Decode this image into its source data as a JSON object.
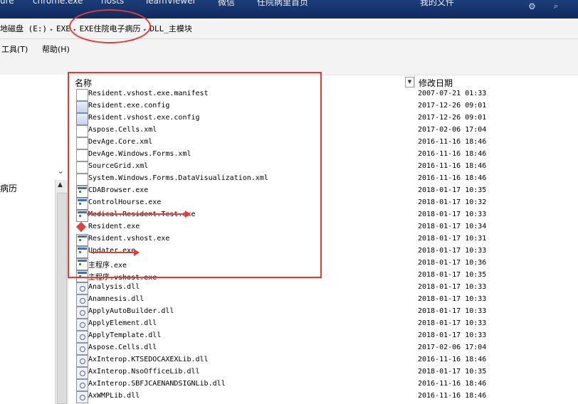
{
  "taskbar": {
    "items": [
      "ure",
      "chrome.exe",
      "hosts",
      "TeamViewer",
      "微信",
      "任院病里首页"
    ],
    "right_text": "我的文件"
  },
  "address": {
    "crumbs": [
      "地磁盘 (E:)",
      "EXE",
      "EXE住院电子病历",
      "DLL_主模块"
    ]
  },
  "menu": {
    "tools": "工具(T)",
    "help": "帮助(H)"
  },
  "nav": {
    "item_label": "病历"
  },
  "columns": {
    "name": "名称",
    "date": "修改日期"
  },
  "files": [
    {
      "name": "Resident.vshost.exe.manifest",
      "date": "2007-07-21 01:33",
      "icon": "doc"
    },
    {
      "name": "Resident.exe.config",
      "date": "2017-12-26 09:01",
      "icon": "cfg"
    },
    {
      "name": "Resident.vshost.exe.config",
      "date": "2017-12-26 09:01",
      "icon": "cfg"
    },
    {
      "name": "Aspose.Cells.xml",
      "date": "2017-02-06 17:04",
      "icon": "doc"
    },
    {
      "name": "DevAge.Core.xml",
      "date": "2016-11-16 18:46",
      "icon": "doc"
    },
    {
      "name": "DevAge.Windows.Forms.xml",
      "date": "2016-11-16 18:46",
      "icon": "doc"
    },
    {
      "name": "SourceGrid.xml",
      "date": "2016-11-16 18:46",
      "icon": "doc"
    },
    {
      "name": "System.Windows.Forms.DataVisualization.xml",
      "date": "2016-11-16 18:46",
      "icon": "doc"
    },
    {
      "name": "CDABrowser.exe",
      "date": "2018-01-17 10:35",
      "icon": "exe"
    },
    {
      "name": "ControlHourse.exe",
      "date": "2018-01-17 10:32",
      "icon": "exe"
    },
    {
      "name": "Medical.Resident.Test.exe",
      "date": "2018-01-17 10:33",
      "icon": "exe"
    },
    {
      "name": "Resident.exe",
      "date": "2018-01-17 10:34",
      "icon": "app"
    },
    {
      "name": "Resident.vshost.exe",
      "date": "2018-01-17 10:31",
      "icon": "exe"
    },
    {
      "name": "Updater.exe",
      "date": "2018-01-17 10:33",
      "icon": "exe"
    },
    {
      "name": "主程序.exe",
      "date": "2018-01-17 10:36",
      "icon": "exe"
    },
    {
      "name": "主程序.vshost.exe",
      "date": "2018-01-17 10:35",
      "icon": "exe"
    },
    {
      "name": "Analysis.dll",
      "date": "2018-01-17 10:33",
      "icon": "dll"
    },
    {
      "name": "Anamnesis.dll",
      "date": "2018-01-17 10:33",
      "icon": "dll"
    },
    {
      "name": "ApplyAutoBuilder.dll",
      "date": "2018-01-17 10:33",
      "icon": "dll"
    },
    {
      "name": "ApplyElement.dll",
      "date": "2018-01-17 10:33",
      "icon": "dll"
    },
    {
      "name": "ApplyTemplate.dll",
      "date": "2018-01-17 10:33",
      "icon": "dll"
    },
    {
      "name": "Aspose.Cells.dll",
      "date": "2017-02-06 17:04",
      "icon": "dll"
    },
    {
      "name": "AxInterop.KTSEDOCAXEXLib.dll",
      "date": "2016-11-16 18:46",
      "icon": "dll"
    },
    {
      "name": "AxInterop.NsoOfficeLib.dll",
      "date": "2018-01-17 10:35",
      "icon": "dll"
    },
    {
      "name": "AxInterop.SBFJCAENANDSIGNLib.dll",
      "date": "2016-11-16 18:46",
      "icon": "dll"
    },
    {
      "name": "AxWMPLib.dll",
      "date": "2016-11-16 18:46",
      "icon": "dll"
    }
  ]
}
